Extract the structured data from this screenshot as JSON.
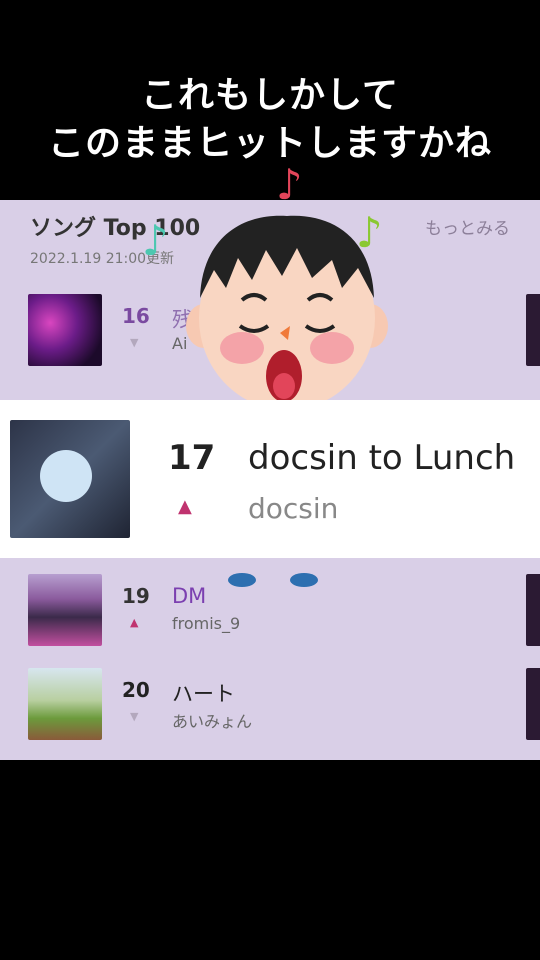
{
  "caption": {
    "line1": "これもしかして",
    "line2": "このままヒットしますかね"
  },
  "chart_panel": {
    "title": "ソング Top 100",
    "updated": "2022.1.19 21:00更新",
    "more_label": "もっとみる"
  },
  "rows": [
    {
      "rank": "16",
      "title": "残",
      "artist": "Ai",
      "trend": "down"
    },
    {
      "rank": "19",
      "title": "DM",
      "artist": "fromis_9",
      "trend": "up"
    },
    {
      "rank": "20",
      "title": "ハート",
      "artist": "あいみょん",
      "trend": "down"
    }
  ],
  "highlight": {
    "rank": "17",
    "title": "docsin to Lunch",
    "artist": "docsin",
    "trend": "up"
  },
  "icons": {
    "up": "▲",
    "down": "▼",
    "note": "♪"
  },
  "colors": {
    "up": "#c0336f",
    "down": "#b3a8bd",
    "note_pink": "#e2455a",
    "note_green": "#8ac832",
    "note_teal": "#4cc7b0"
  }
}
